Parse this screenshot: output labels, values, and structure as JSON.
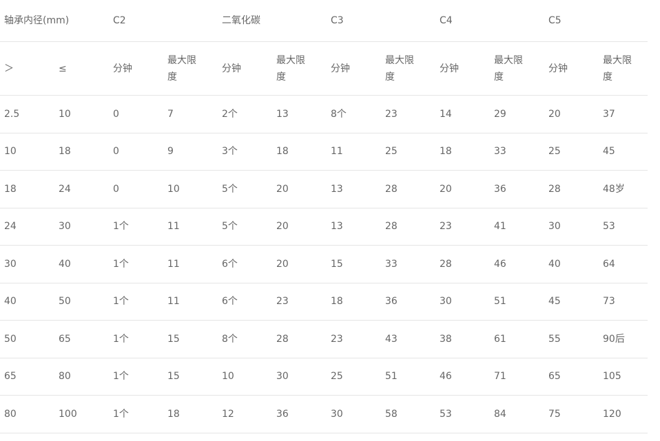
{
  "header": {
    "bore": "轴承内径(mm)",
    "groups": [
      "C2",
      "二氧化碳",
      "C3",
      "C4",
      "C5"
    ]
  },
  "subheader": [
    "＞",
    "≤",
    "分钟",
    "最大限度",
    "分钟",
    "最大限度",
    "分钟",
    "最大限度",
    "分钟",
    "最大限度",
    "分钟",
    "最大限度"
  ],
  "rows": [
    [
      "2.5",
      "10",
      "0",
      "7",
      "2个",
      "13",
      "8个",
      "23",
      "14",
      "29",
      "20",
      "37"
    ],
    [
      "10",
      "18",
      "0",
      "9",
      "3个",
      "18",
      "11",
      "25",
      "18",
      "33",
      "25",
      "45"
    ],
    [
      "18",
      "24",
      "0",
      "10",
      "5个",
      "20",
      "13",
      "28",
      "20",
      "36",
      "28",
      "48岁"
    ],
    [
      "24",
      "30",
      "1个",
      "11",
      "5个",
      "20",
      "13",
      "28",
      "23",
      "41",
      "30",
      "53"
    ],
    [
      "30",
      "40",
      "1个",
      "11",
      "6个",
      "20",
      "15",
      "33",
      "28",
      "46",
      "40",
      "64"
    ],
    [
      "40",
      "50",
      "1个",
      "11",
      "6个",
      "23",
      "18",
      "36",
      "30",
      "51",
      "45",
      "73"
    ],
    [
      "50",
      "65",
      "1个",
      "15",
      "8个",
      "28",
      "23",
      "43",
      "38",
      "61",
      "55",
      "90后"
    ],
    [
      "65",
      "80",
      "1个",
      "15",
      "10",
      "30",
      "25",
      "51",
      "46",
      "71",
      "65",
      "105"
    ],
    [
      "80",
      "100",
      "1个",
      "18",
      "12",
      "36",
      "30",
      "58",
      "53",
      "84",
      "75",
      "120"
    ]
  ]
}
